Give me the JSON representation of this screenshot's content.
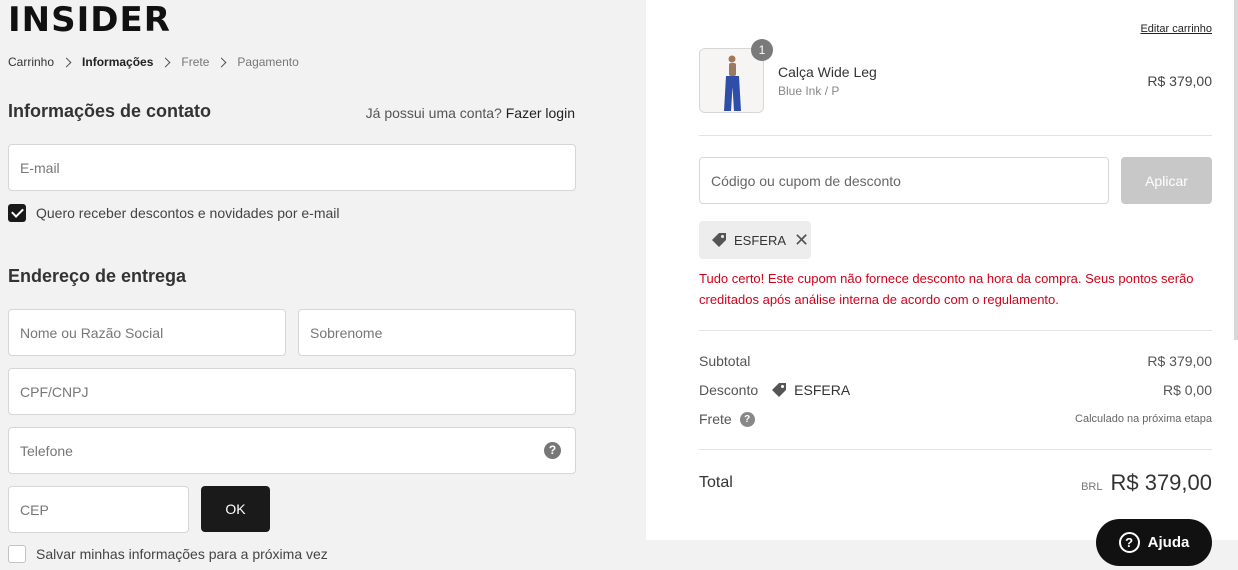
{
  "brand": {
    "logo_text": "INSIDER"
  },
  "breadcrumb": [
    {
      "label": "Carrinho",
      "state": "done"
    },
    {
      "label": "Informações",
      "state": "active"
    },
    {
      "label": "Frete",
      "state": "pending"
    },
    {
      "label": "Pagamento",
      "state": "pending"
    }
  ],
  "contact": {
    "title": "Informações de contato",
    "has_account_text": "Já possui uma conta?",
    "login_link": "Fazer login",
    "email_placeholder": "E-mail",
    "newsletter_label": "Quero receber descontos e novidades por e-mail",
    "newsletter_checked": true
  },
  "shipping": {
    "title": "Endereço de entrega",
    "name_placeholder": "Nome ou Razão Social",
    "surname_placeholder": "Sobrenome",
    "doc_placeholder": "CPF/CNPJ",
    "phone_placeholder": "Telefone",
    "cep_placeholder": "CEP",
    "ok_label": "OK",
    "save_info_label": "Salvar minhas informações para a próxima vez",
    "save_info_checked": false
  },
  "cart": {
    "edit_label": "Editar carrinho",
    "item": {
      "quantity": "1",
      "name": "Calça Wide Leg",
      "variant": "Blue Ink / P",
      "price": "R$ 379,00"
    },
    "coupon_placeholder": "Código ou cupom de desconto",
    "apply_label": "Aplicar",
    "applied_coupon": "ESFERA",
    "coupon_message": "Tudo certo! Este cupom não fornece desconto na hora da compra. Seus pontos serão creditados após análise interna de acordo com o regulamento."
  },
  "summary": {
    "subtotal_label": "Subtotal",
    "subtotal_value": "R$ 379,00",
    "discount_label": "Desconto",
    "discount_code": "ESFERA",
    "discount_value": "R$ 0,00",
    "shipping_label": "Frete",
    "shipping_value": "Calculado na próxima etapa",
    "total_label": "Total",
    "currency": "BRL",
    "total_value": "R$ 379,00"
  },
  "help": {
    "label": "Ajuda"
  },
  "colors": {
    "left_bg": "#f2f2f2",
    "dark_button": "#1a1a1a",
    "apply_disabled": "#c8c8c8",
    "success_message": "#d0021b"
  }
}
